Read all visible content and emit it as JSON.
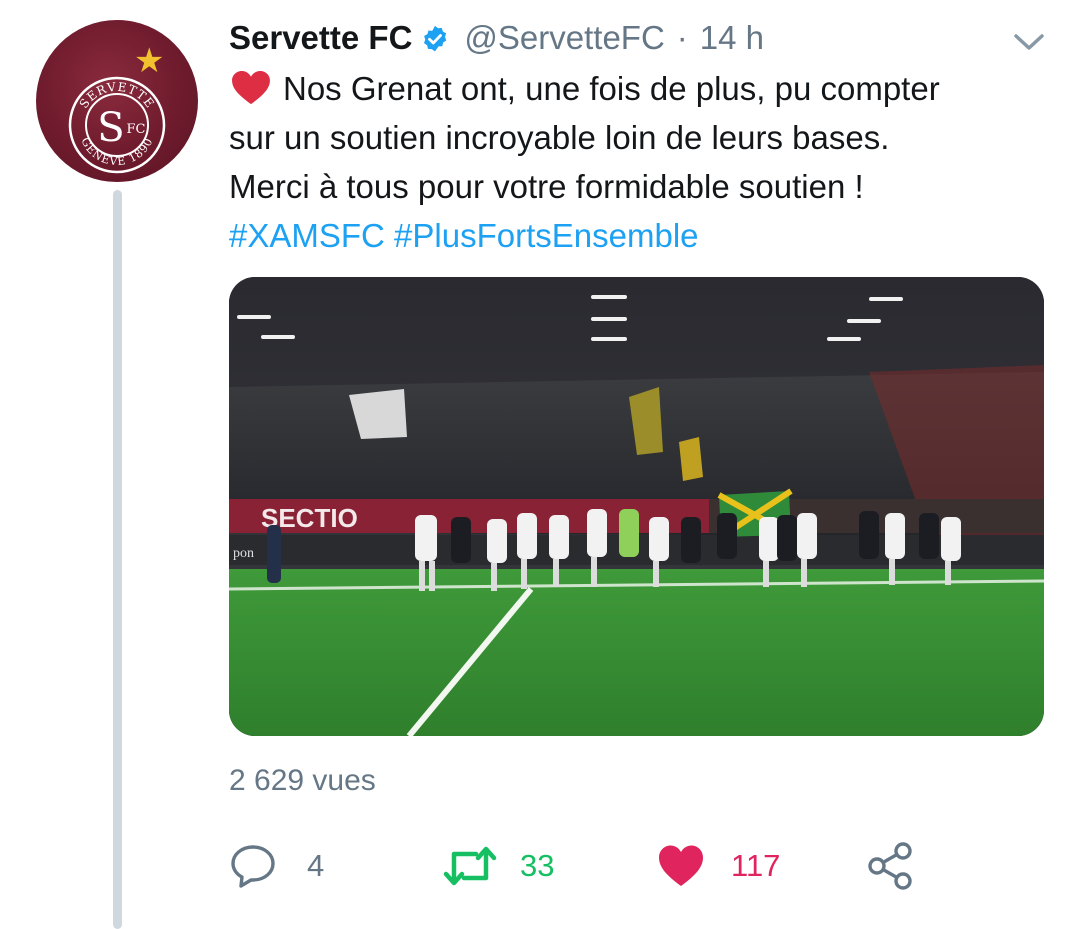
{
  "tweet": {
    "display_name": "Servette FC",
    "handle": "@ServetteFC",
    "separator": "·",
    "time": "14 h",
    "text_lines": [
      "Nos Grenat ont, une fois de plus, pu compter",
      "sur un soutien incroyable loin de leurs bases.",
      "Merci à tous pour votre formidable soutien !"
    ],
    "hashtags": [
      "#XAMSFC",
      "#PlusFortsEnsemble"
    ],
    "views": "2 629 vues"
  },
  "avatar": {
    "crest_top": "SERVETTE",
    "crest_bottom": "GENEVE 1890",
    "crest_letter": "S",
    "crest_fc": "FC"
  },
  "media": {
    "banner_text": "SECTIO",
    "banner_text_2": "pon"
  },
  "actions": {
    "replies": "4",
    "retweets": "33",
    "likes": "117"
  },
  "icons": {
    "verified": "verified-badge-icon",
    "chevron": "chevron-down-icon",
    "reply": "reply-icon",
    "retweet": "retweet-icon",
    "like": "heart-icon",
    "share": "share-icon"
  },
  "colors": {
    "brand_maroon": "#6e1b2d",
    "link_blue": "#1da1f2",
    "retweet_green": "#17bf63",
    "like_red": "#e0245e",
    "muted_gray": "#657786"
  }
}
